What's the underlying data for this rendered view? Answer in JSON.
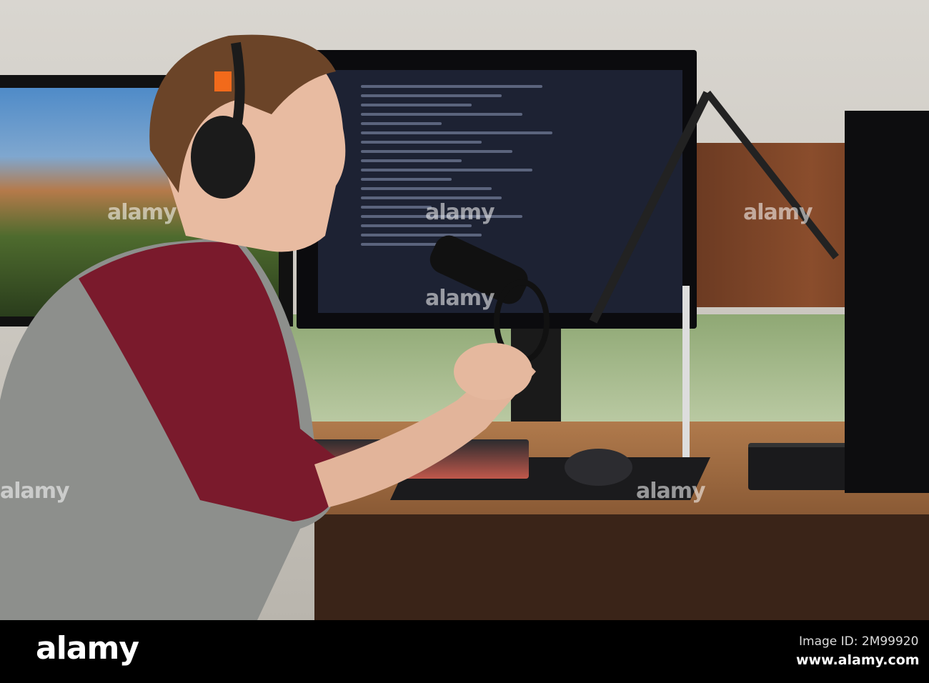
{
  "watermark": {
    "text": "alamy"
  },
  "footer": {
    "logo": "alamy",
    "image_id": "Image ID: 2M99920",
    "url": "www.alamy.com"
  },
  "colors": {
    "shirt": "#7a1a2c",
    "sleeve": "#8d8f8c",
    "desk": "#8a5a35",
    "screen": "#1d2233",
    "headphone_accent": "#f26a1b"
  }
}
